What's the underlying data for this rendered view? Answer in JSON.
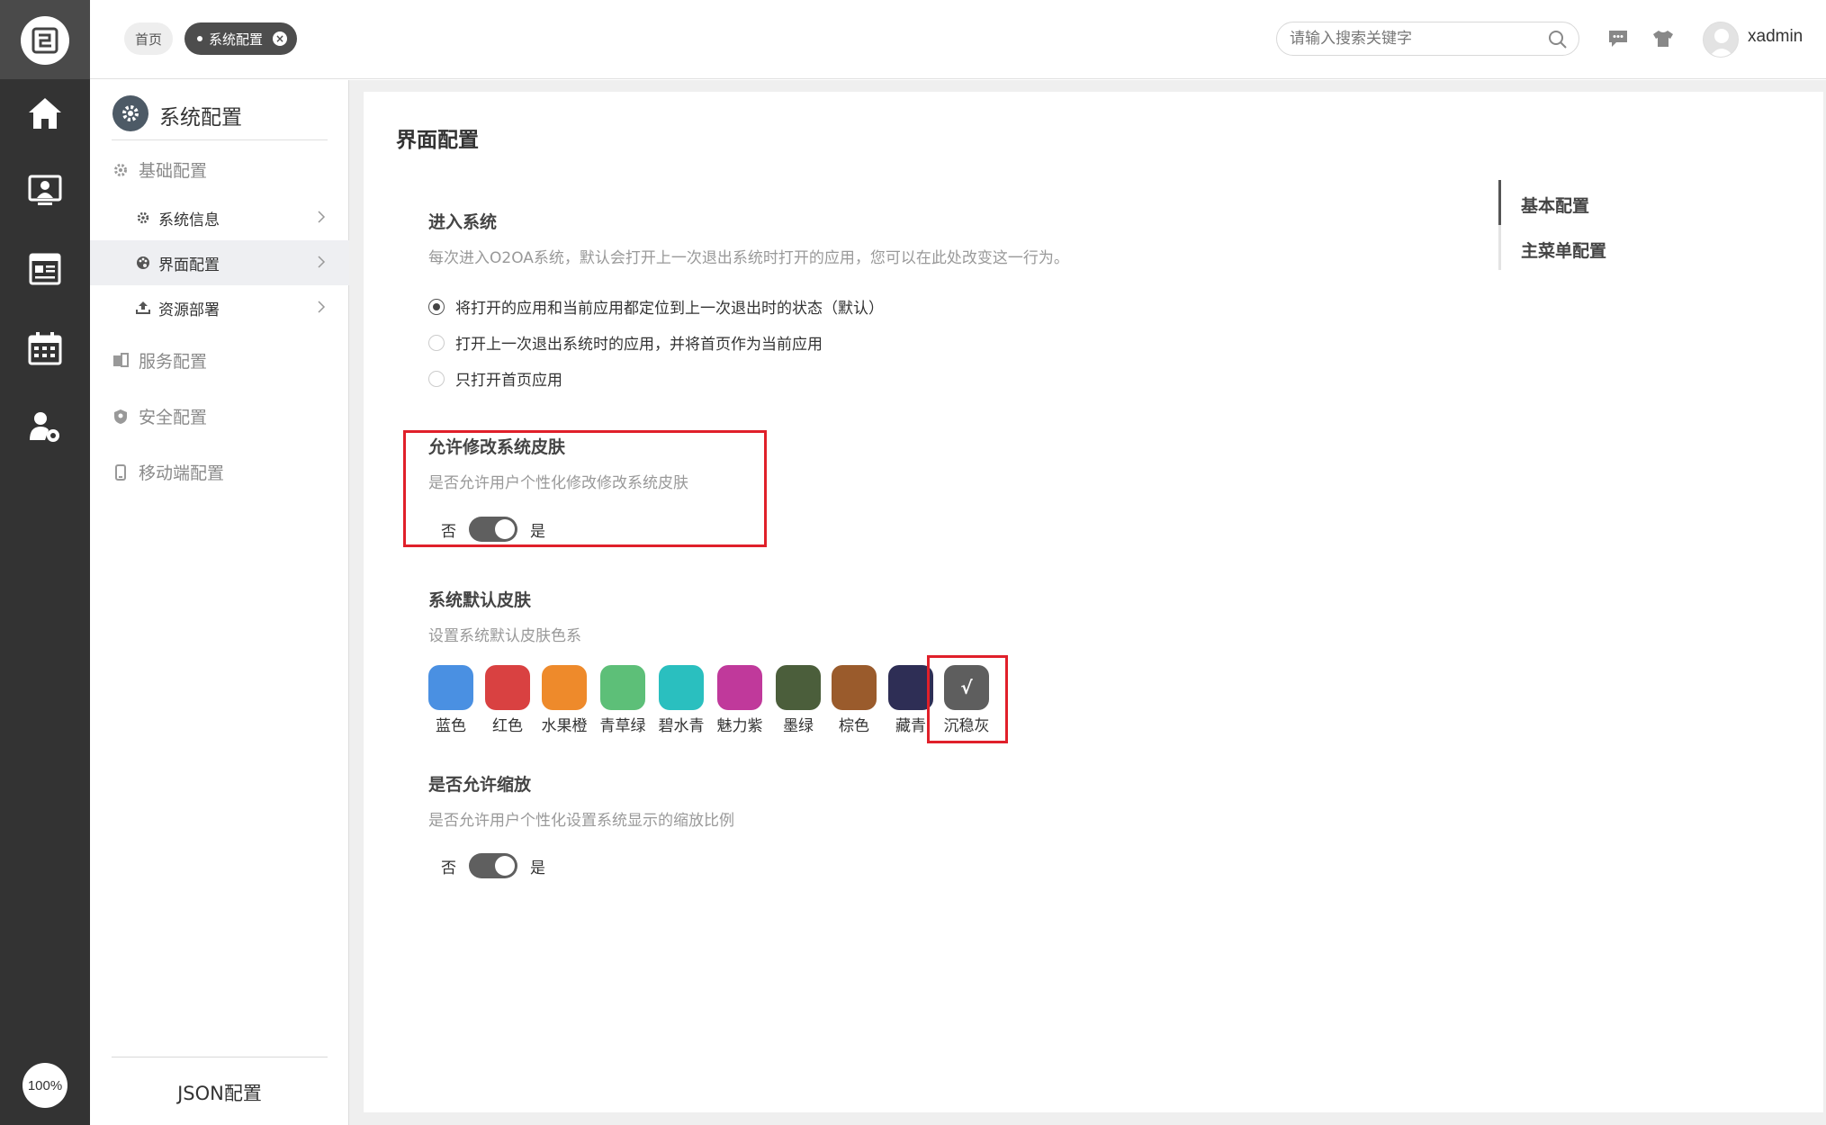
{
  "header": {
    "tabs": [
      {
        "label": "首页"
      },
      {
        "label": "系统配置"
      }
    ],
    "search_placeholder": "请输入搜索关键字",
    "username": "xadmin"
  },
  "leftnav": {
    "icons": [
      "home-icon",
      "contacts-icon",
      "news-icon",
      "calendar-icon",
      "admin-settings-icon"
    ],
    "zoom": "100%"
  },
  "sidemenu": {
    "title": "系统配置",
    "groups": [
      {
        "label": "基础配置",
        "icon": "gear-icon"
      },
      {
        "label": "服务配置",
        "icon": "service-icon"
      },
      {
        "label": "安全配置",
        "icon": "shield-icon"
      },
      {
        "label": "移动端配置",
        "icon": "mobile-icon"
      }
    ],
    "sub_items": [
      {
        "label": "系统信息",
        "icon": "gear-icon"
      },
      {
        "label": "界面配置",
        "icon": "palette-icon"
      },
      {
        "label": "资源部署",
        "icon": "upload-icon"
      }
    ],
    "json_config": "JSON配置"
  },
  "main": {
    "title": "界面配置",
    "enter_system": {
      "title": "进入系统",
      "desc": "每次进入O2OA系统，默认会打开上一次退出系统时打开的应用，您可以在此处改变这一行为。",
      "options": [
        "将打开的应用和当前应用都定位到上一次退出时的状态（默认）",
        "打开上一次退出系统时的应用，并将首页作为当前应用",
        "只打开首页应用"
      ],
      "selected_index": 0
    },
    "allow_skin": {
      "title": "允许修改系统皮肤",
      "desc": "是否允许用户个性化修改修改系统皮肤",
      "off_label": "否",
      "on_label": "是",
      "value": true
    },
    "default_skin": {
      "title": "系统默认皮肤",
      "desc": "设置系统默认皮肤色系",
      "check_mark": "√",
      "colors": [
        {
          "label": "蓝色",
          "color": "#4a90e2"
        },
        {
          "label": "红色",
          "color": "#d94141"
        },
        {
          "label": "水果橙",
          "color": "#ee8a2b"
        },
        {
          "label": "青草绿",
          "color": "#5dbf78"
        },
        {
          "label": "碧水青",
          "color": "#2abfbf"
        },
        {
          "label": "魅力紫",
          "color": "#c0399b"
        },
        {
          "label": "墨绿",
          "color": "#4b5e3b"
        },
        {
          "label": "棕色",
          "color": "#9a5b2c"
        },
        {
          "label": "藏青",
          "color": "#2e2e55"
        },
        {
          "label": "沉稳灰",
          "color": "#5e5e5e"
        }
      ],
      "selected_index": 9
    },
    "allow_zoom": {
      "title": "是否允许缩放",
      "desc": "是否允许用户个性化设置系统显示的缩放比例",
      "off_label": "否",
      "on_label": "是",
      "value": true
    },
    "anchors": [
      "基本配置",
      "主菜单配置"
    ]
  }
}
